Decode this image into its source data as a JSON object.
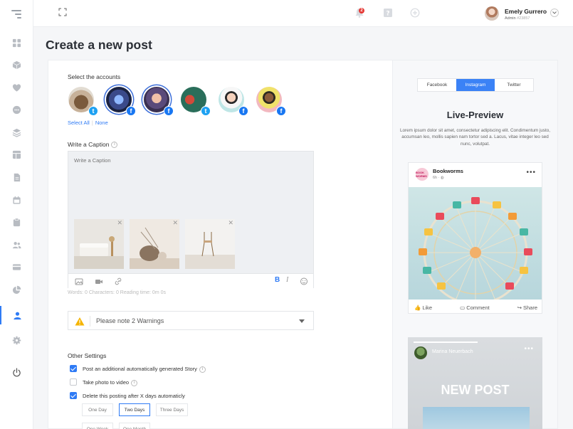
{
  "colors": {
    "accent": "#2f7bf5",
    "facebook": "#1877f2",
    "twitter": "#1da1f2",
    "warning": "#f5b400",
    "badge": "#e53935"
  },
  "sidebar": {
    "items": [
      {
        "icon": "dashboard-icon"
      },
      {
        "icon": "cube-icon"
      },
      {
        "icon": "heart-icon"
      },
      {
        "icon": "chat-icon"
      },
      {
        "icon": "layers-icon"
      },
      {
        "icon": "layout-icon"
      },
      {
        "icon": "document-icon"
      },
      {
        "icon": "calendar-icon"
      },
      {
        "icon": "clipboard-icon"
      },
      {
        "icon": "users-icon"
      },
      {
        "icon": "card-icon"
      },
      {
        "icon": "pie-chart-icon"
      },
      {
        "icon": "user-icon",
        "active": true
      },
      {
        "icon": "settings-icon"
      },
      {
        "icon": "power-icon"
      }
    ]
  },
  "topbar": {
    "notification_count": "2",
    "user": {
      "name": "Emely Gurrero",
      "role": "Admin",
      "id": "#23857"
    }
  },
  "page_title": "Create a new post",
  "accounts": {
    "label": "Select the accounts",
    "select_all": "Select All",
    "none": "None",
    "list": [
      {
        "network": "twitter",
        "selected": false
      },
      {
        "network": "facebook",
        "selected": true
      },
      {
        "network": "facebook",
        "selected": true
      },
      {
        "network": "twitter",
        "selected": false
      },
      {
        "network": "facebook",
        "selected": false
      },
      {
        "network": "facebook",
        "selected": false
      }
    ]
  },
  "caption": {
    "label": "Write a Caption",
    "placeholder": "Write a Caption",
    "stats": "Words: 0  Characters: 0  Reading time: 0m 0s"
  },
  "warning": {
    "text": "Please note 2 Warnings"
  },
  "other_settings": {
    "label": "Other Settings",
    "options": [
      {
        "label": "Post an additional automatically generated Story",
        "checked": true,
        "info": true
      },
      {
        "label": "Take photo to video",
        "checked": false,
        "info": true
      },
      {
        "label": "Delete this posting after X days automaticly",
        "checked": true,
        "info": false
      }
    ],
    "day_options": [
      "One Day",
      "Two Days",
      "Three Days"
    ],
    "selected_day": "Two Days",
    "week_options": [
      "One Week",
      "One Month"
    ]
  },
  "preview": {
    "tabs": [
      "Facebook",
      "Instagram",
      "Twitter"
    ],
    "active_tab": "Instagram",
    "title": "Live-Preview",
    "text": "Lorem ipsum dolor sit amet, consectetur adipiscing elit. Condimentum justo, accumsan leo, mollis sapien nam tortor sed a. Lacus, vitae integer leo sed nunc, volutpat.",
    "fb_post": {
      "page": "Bookworms",
      "avatar_text": "BOOK WORMS",
      "time": "6h · ",
      "like": "Like",
      "comment": "Comment",
      "share": "Share"
    },
    "story": {
      "user": "Marina Neuerbach",
      "headline": "NEW POST"
    }
  }
}
